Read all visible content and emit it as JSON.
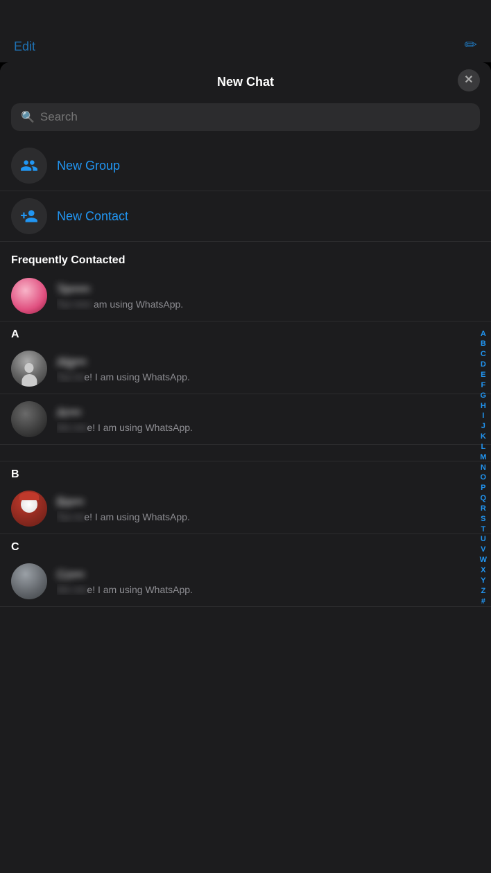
{
  "topBar": {
    "editLabel": "Edit",
    "composeIcon": "✏"
  },
  "header": {
    "title": "New Chat",
    "closeLabel": "✕"
  },
  "search": {
    "placeholder": "Search"
  },
  "actions": [
    {
      "id": "new-group",
      "label": "New Group",
      "iconType": "group"
    },
    {
      "id": "new-contact",
      "label": "New Contact",
      "iconType": "add-person"
    }
  ],
  "frequentlyContacted": {
    "sectionLabel": "Frequently Contacted",
    "contacts": [
      {
        "name": "Ta——",
        "status": "am using WhatsApp.",
        "avatarType": "pink"
      }
    ]
  },
  "sections": [
    {
      "letter": "A",
      "contacts": [
        {
          "name": "Alg——",
          "status": "e! I am using WhatsApp.",
          "avatarType": "person-gray"
        },
        {
          "name": "Ar——",
          "status": "e! I am using WhatsApp.",
          "avatarType": "dark-blur"
        }
      ]
    },
    {
      "letter": "B",
      "contacts": [
        {
          "name": "Ba——",
          "status": "e! I am using WhatsApp.",
          "avatarType": "red-character"
        }
      ]
    },
    {
      "letter": "C",
      "contacts": []
    }
  ],
  "alphabetIndex": [
    "A",
    "B",
    "C",
    "D",
    "E",
    "F",
    "G",
    "H",
    "I",
    "J",
    "K",
    "L",
    "M",
    "N",
    "O",
    "P",
    "Q",
    "R",
    "S",
    "T",
    "U",
    "V",
    "W",
    "X",
    "Y",
    "Z",
    "#"
  ]
}
